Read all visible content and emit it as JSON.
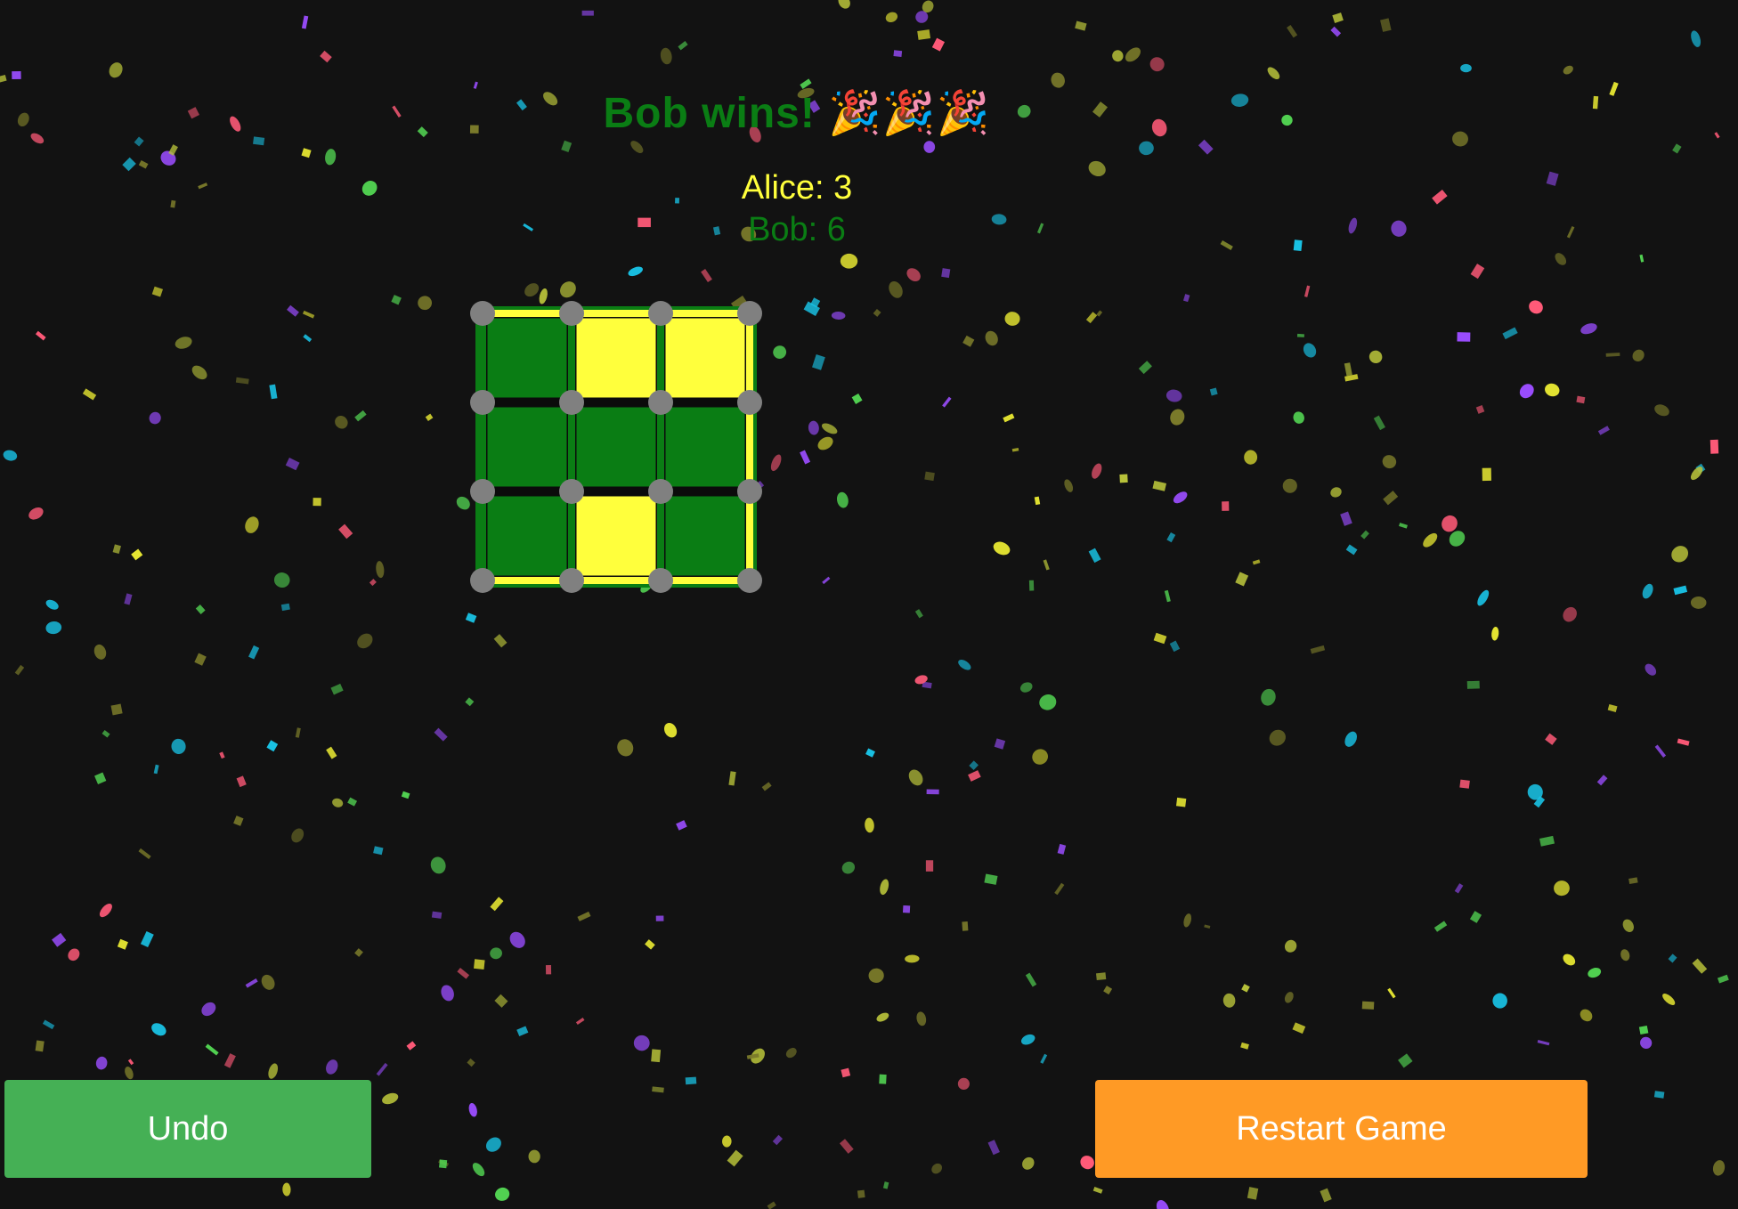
{
  "headline": {
    "text": "Bob wins! 🎉🎉🎉",
    "color": "#0a7d14"
  },
  "players": [
    {
      "name": "Alice",
      "score_text": "Alice: 3",
      "color": "#ffff3c"
    },
    {
      "name": "Bob",
      "score_text": "Bob: 6",
      "color": "#0a7d14"
    }
  ],
  "board": {
    "rows": 3,
    "cols": 3,
    "cell_owners": [
      [
        "Bob",
        "Alice",
        "Alice"
      ],
      [
        "Bob",
        "Bob",
        "Bob"
      ],
      [
        "Bob",
        "Alice",
        "Bob"
      ]
    ],
    "dot_color": "#808080"
  },
  "buttons": {
    "undo": {
      "label": "Undo",
      "color": "#45b055"
    },
    "restart": {
      "label": "Restart Game",
      "color": "#ff9a25"
    }
  },
  "confetti_colors": [
    "#9b4dff",
    "#ff5a78",
    "#19c3e6",
    "#e6e632",
    "#52d352",
    "#b7c13a",
    "#7a7a2a"
  ]
}
